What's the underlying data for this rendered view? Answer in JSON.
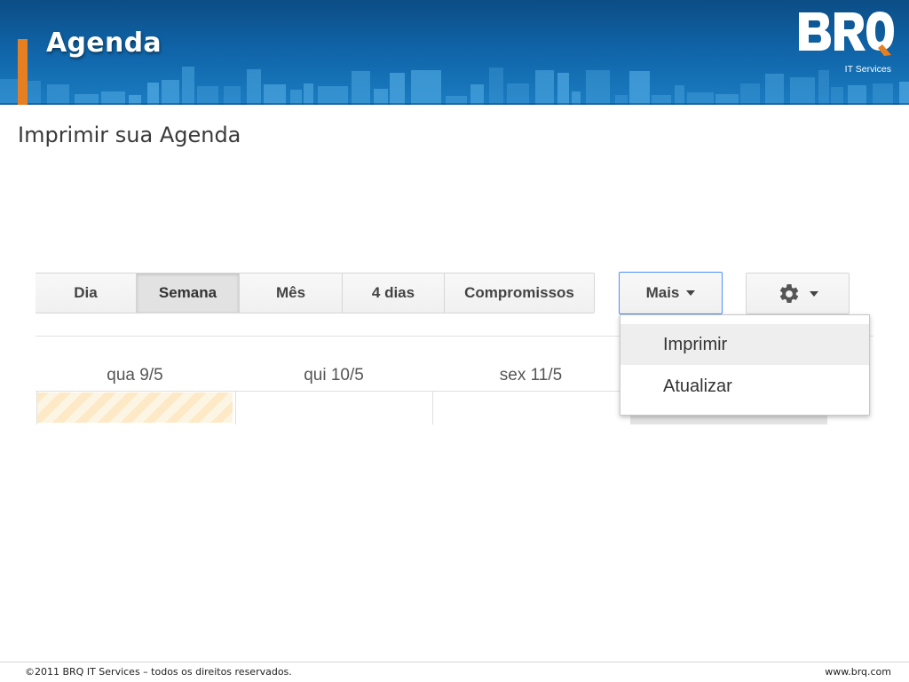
{
  "header": {
    "title": "Agenda",
    "logo_text": "BRQ",
    "logo_subtitle": "IT Services",
    "colors": {
      "band": "#0f63a6",
      "accent": "#e67e22",
      "logo_q_tail": "#e67e22"
    }
  },
  "slide": {
    "subtitle": "Imprimir sua Agenda"
  },
  "calendar": {
    "view_tabs": [
      "Dia",
      "Semana",
      "Mês",
      "4 dias",
      "Compromissos"
    ],
    "active_view": "Semana",
    "more_button": {
      "label": "Mais",
      "icon": "chevron-down-icon",
      "state": "open"
    },
    "settings_button": {
      "icon": "gear-icon"
    },
    "more_menu": {
      "items": [
        "Imprimir",
        "Atualizar"
      ],
      "highlighted": "Imprimir"
    },
    "day_headers": [
      "qua 9/5",
      "qui 10/5",
      "sex 11/5"
    ],
    "today_highlight": "qua 9/5",
    "colors": {
      "focus_border": "#4d90fe",
      "today_stripe": "#fde9c6"
    }
  },
  "footer": {
    "copyright": "©2011 BRQ IT Services – todos os direitos reservados.",
    "website": "www.brq.com"
  }
}
